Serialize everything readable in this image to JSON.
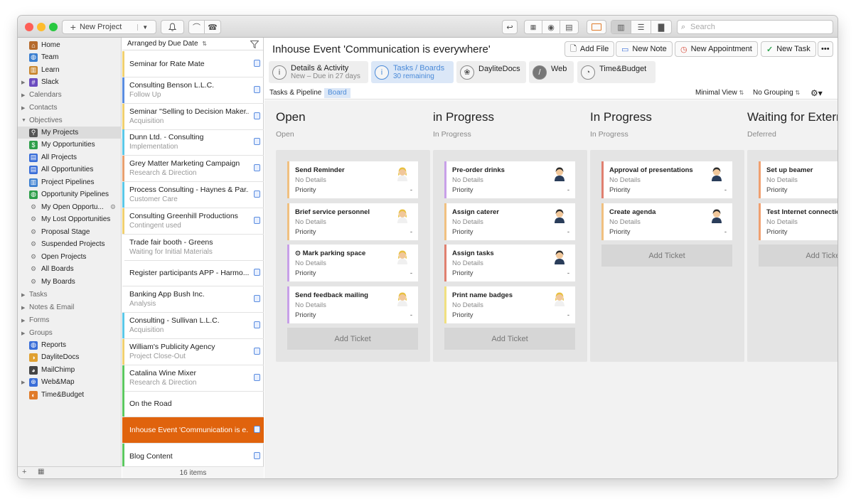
{
  "toolbar": {
    "new_project_label": "New Project",
    "search_placeholder": "Search"
  },
  "sidebar": {
    "items": [
      {
        "label": "Home",
        "icon": "home-icon"
      },
      {
        "label": "Team",
        "icon": "globe-icon"
      },
      {
        "label": "Learn",
        "icon": "books-icon"
      },
      {
        "label": "Slack",
        "icon": "slack-icon"
      },
      {
        "label": "Calendars",
        "icon": ""
      },
      {
        "label": "Contacts",
        "icon": ""
      },
      {
        "label": "Objectives",
        "icon": ""
      },
      {
        "label": "My Projects",
        "icon": "person-icon"
      },
      {
        "label": "My Opportunities",
        "icon": "dollar-icon"
      },
      {
        "label": "All Projects",
        "icon": "project-icon"
      },
      {
        "label": "All Opportunities",
        "icon": "opportunity-icon"
      },
      {
        "label": "Project Pipelines",
        "icon": "pipeline-icon"
      },
      {
        "label": "Opportunity Pipelines",
        "icon": "pipeline-icon"
      },
      {
        "label": "My Open Opportu...",
        "icon": "smart-filter-icon"
      },
      {
        "label": "My Lost Opportunities",
        "icon": "smart-filter-icon"
      },
      {
        "label": "Proposal Stage",
        "icon": "smart-filter-icon"
      },
      {
        "label": "Suspended Projects",
        "icon": "smart-filter-icon"
      },
      {
        "label": "Open Projects",
        "icon": "smart-filter-icon"
      },
      {
        "label": "All Boards",
        "icon": "smart-filter-icon"
      },
      {
        "label": "My Boards",
        "icon": "smart-filter-icon"
      },
      {
        "label": "Tasks",
        "icon": ""
      },
      {
        "label": "Notes & Email",
        "icon": ""
      },
      {
        "label": "Forms",
        "icon": ""
      },
      {
        "label": "Groups",
        "icon": ""
      },
      {
        "label": "Reports",
        "icon": "reports-icon"
      },
      {
        "label": "DayliteDocs",
        "icon": "daylitedocs-icon"
      },
      {
        "label": "MailChimp",
        "icon": "mailchimp-icon"
      },
      {
        "label": "Web&Map",
        "icon": "webmap-icon"
      },
      {
        "label": "Time&Budget",
        "icon": "timebudget-icon"
      }
    ]
  },
  "list": {
    "header": "Arranged by Due Date",
    "footer": "16 items",
    "items": [
      {
        "title": "Seminar for Rate Mate",
        "subtitle": "",
        "color": "#f0d070"
      },
      {
        "title": "Consulting Benson L.L.C.",
        "subtitle": "Follow Up",
        "color": "#5b8de0"
      },
      {
        "title": "Seminar \"Selling to Decision Maker...",
        "subtitle": "Acquisition",
        "color": "#f0d070"
      },
      {
        "title": "Dunn Ltd. - Consulting",
        "subtitle": "Implementation",
        "color": "#5bc8e8"
      },
      {
        "title": "Grey Matter Marketing Campaign",
        "subtitle": "Research & Direction",
        "color": "#e8a070"
      },
      {
        "title": "Process Consulting - Haynes & Par...",
        "subtitle": "Customer Care",
        "color": "#5bc8e8"
      },
      {
        "title": "Consulting Greenhill Productions",
        "subtitle": "Contingent used",
        "color": "#f0d070"
      },
      {
        "title": "Trade fair booth - Greens",
        "subtitle": "Waiting for Initial Materials",
        "color": "#ffffff"
      },
      {
        "title": "Register participants APP - Harmo...",
        "subtitle": "",
        "color": "#ffffff"
      },
      {
        "title": "Banking App Bush Inc.",
        "subtitle": "Analysis",
        "color": "#ffffff"
      },
      {
        "title": "Consulting - Sullivan L.L.C.",
        "subtitle": "Acquisition",
        "color": "#5bc8e8"
      },
      {
        "title": "William's Publicity Agency",
        "subtitle": "Project Close-Out",
        "color": "#f0d070"
      },
      {
        "title": "Catalina Wine Mixer",
        "subtitle": "Research & Direction",
        "color": "#5cc860"
      },
      {
        "title": "On the Road",
        "subtitle": "",
        "color": "#5cc860"
      },
      {
        "title": "Inhouse Event 'Communication is e...",
        "subtitle": "",
        "color": "#e0630d"
      },
      {
        "title": "Blog Content",
        "subtitle": "",
        "color": "#5cc860"
      }
    ]
  },
  "main": {
    "title": "Inhouse Event 'Communication is everywhere'",
    "actions": {
      "add_file": "Add File",
      "new_note": "New Note",
      "new_appointment": "New Appointment",
      "new_task": "New Task",
      "more": "•••"
    },
    "tabs": [
      {
        "label": "Details & Activity",
        "sub": "New – Due in 27 days"
      },
      {
        "label": "Tasks / Boards",
        "sub": "30 remaining"
      },
      {
        "label": "DayliteDocs",
        "sub": ""
      },
      {
        "label": "Web",
        "sub": ""
      },
      {
        "label": "Time&Budget",
        "sub": ""
      }
    ],
    "subnav": {
      "tasks_pipeline": "Tasks & Pipeline",
      "board": "Board",
      "view": "Minimal View",
      "grouping": "No Grouping"
    }
  },
  "board": {
    "add_ticket": "Add Ticket",
    "columns": [
      {
        "title": "Open",
        "subtitle": "Open",
        "cards": [
          {
            "title": "Send Reminder",
            "details": "No Details",
            "priority": "Priority",
            "value": "-",
            "color": "#f0c080"
          },
          {
            "title": "Brief service personnel",
            "details": "No Details",
            "priority": "Priority",
            "value": "-",
            "color": "#f0c080"
          },
          {
            "title": "⊙ Mark parking space",
            "details": "No Details",
            "priority": "Priority",
            "value": "-",
            "color": "#c8a0e8"
          },
          {
            "title": "Send feedback mailing",
            "details": "No Details",
            "priority": "Priority",
            "value": "-",
            "color": "#c8a0e8"
          }
        ]
      },
      {
        "title": "in Progress",
        "subtitle": "In Progress",
        "cards": [
          {
            "title": "Pre-order drinks",
            "details": "No Details",
            "priority": "Priority",
            "value": "-",
            "color": "#c8a0e8"
          },
          {
            "title": "Assign caterer",
            "details": "No Details",
            "priority": "Priority",
            "value": "-",
            "color": "#f0c080"
          },
          {
            "title": "Assign tasks",
            "details": "No Details",
            "priority": "Priority",
            "value": "-",
            "color": "#e08070"
          },
          {
            "title": "Print name badges",
            "details": "No Details",
            "priority": "Priority",
            "value": "-",
            "color": "#f0e080"
          }
        ]
      },
      {
        "title": "In Progress",
        "subtitle": "In Progress",
        "cards": [
          {
            "title": "Approval of presentations",
            "details": "No Details",
            "priority": "Priority",
            "value": "-",
            "color": "#e08070"
          },
          {
            "title": "Create agenda",
            "details": "No Details",
            "priority": "Priority",
            "value": "-",
            "color": "#f0c080"
          }
        ]
      },
      {
        "title": "Waiting for Extern",
        "subtitle": "Deferred",
        "cards": [
          {
            "title": "Set up beamer",
            "details": "No Details",
            "priority": "Priority",
            "value": "",
            "color": "#f0a070"
          },
          {
            "title": "Test Internet connection",
            "details": "No Details",
            "priority": "Priority",
            "value": "",
            "color": "#f0a070"
          }
        ]
      }
    ]
  }
}
